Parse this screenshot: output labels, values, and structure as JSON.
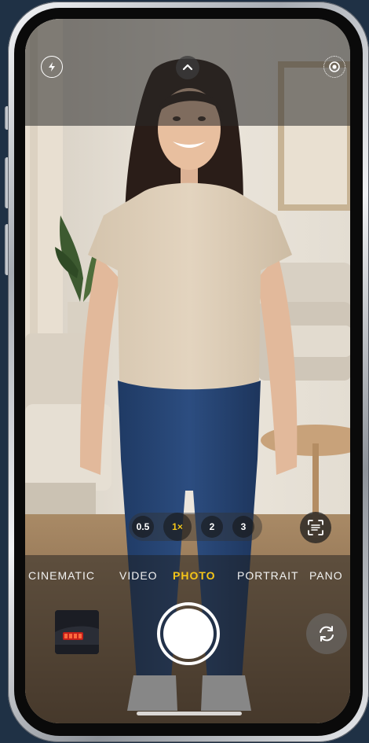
{
  "camera": {
    "top_bar": {
      "flash_icon": "flash-icon",
      "chevron_icon": "chevron-up-icon",
      "live_photo_icon": "live-photo-icon"
    },
    "zoom_levels": [
      "0.5",
      "1×",
      "2",
      "3"
    ],
    "active_zoom": "1×",
    "modes": [
      "CINEMATIC",
      "VIDEO",
      "PHOTO",
      "PORTRAIT",
      "PANO"
    ],
    "active_mode": "PHOTO",
    "accent_color": "#f5c518",
    "bottom_bar": {
      "thumbnail_icon": "last-photo-thumbnail",
      "shutter_icon": "shutter-button",
      "flip_icon": "camera-flip-icon",
      "scan_icon": "text-scan-icon"
    }
  }
}
